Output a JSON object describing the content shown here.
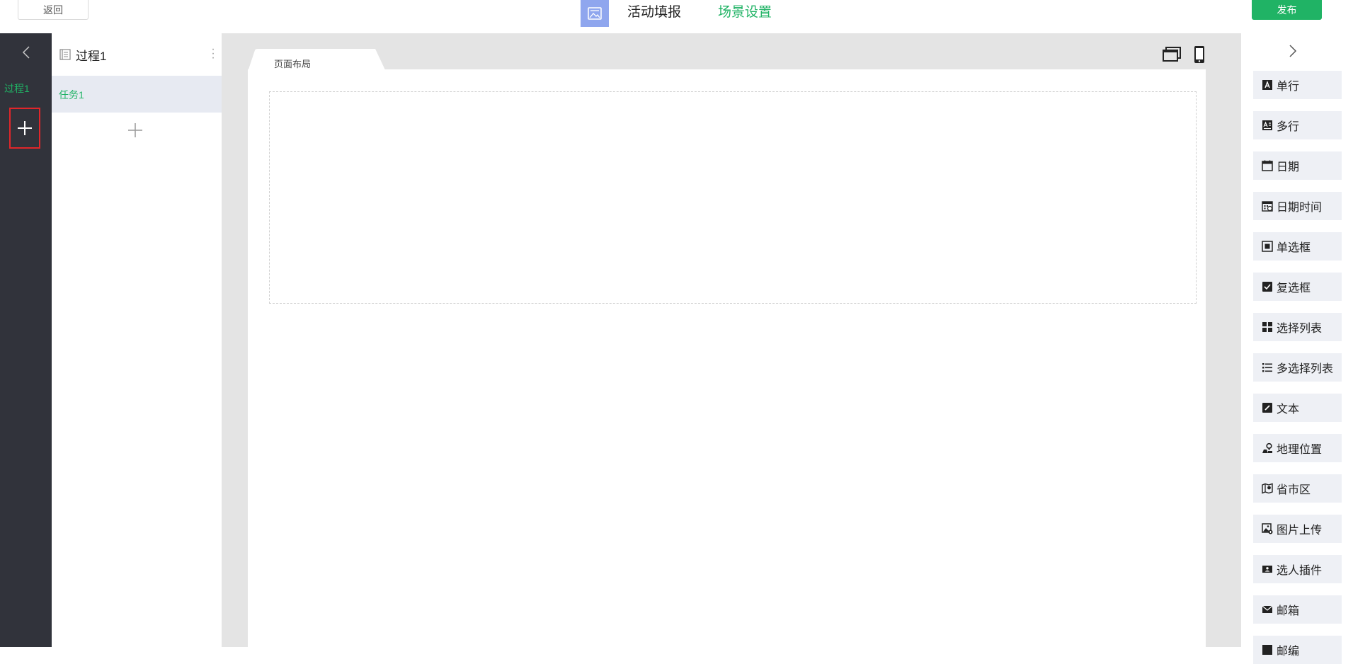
{
  "topbar": {
    "back_label": "返回",
    "app_icon": "image-gallery-icon",
    "tab_fill": "活动填报",
    "tab_scene": "场景设置",
    "publish_label": "发布"
  },
  "leftrail": {
    "collapse_icon": "chevron-left-icon",
    "process_label": "过程1",
    "add_icon": "plus-icon"
  },
  "process_panel": {
    "title": "过程1",
    "tasks": [
      {
        "label": "任务1"
      }
    ],
    "add_task_icon": "plus-icon"
  },
  "canvas": {
    "tab_label": "页面布局",
    "device_icons": [
      "desktop-icon",
      "mobile-icon"
    ]
  },
  "widgets": [
    {
      "label": "单行",
      "icon": "single-line-icon"
    },
    {
      "label": "多行",
      "icon": "multi-line-icon"
    },
    {
      "label": "日期",
      "icon": "calendar-icon"
    },
    {
      "label": "日期时间",
      "icon": "calendar-clock-icon"
    },
    {
      "label": "单选框",
      "icon": "radio-icon"
    },
    {
      "label": "复选框",
      "icon": "checkbox-icon"
    },
    {
      "label": "选择列表",
      "icon": "grid-icon"
    },
    {
      "label": "多选择列表",
      "icon": "list-icon"
    },
    {
      "label": "文本",
      "icon": "edit-icon"
    },
    {
      "label": "地理位置",
      "icon": "location-icon"
    },
    {
      "label": "省市区",
      "icon": "map-icon"
    },
    {
      "label": "图片上传",
      "icon": "image-upload-icon"
    },
    {
      "label": "选人插件",
      "icon": "contact-card-icon"
    },
    {
      "label": "邮箱",
      "icon": "mail-icon"
    },
    {
      "label": "邮编",
      "icon": "postcode-icon"
    }
  ],
  "colors": {
    "accent": "#20b365",
    "rail_bg": "#31333b",
    "highlight": "#e0262a",
    "icon_bg": "#8fa6ee"
  }
}
